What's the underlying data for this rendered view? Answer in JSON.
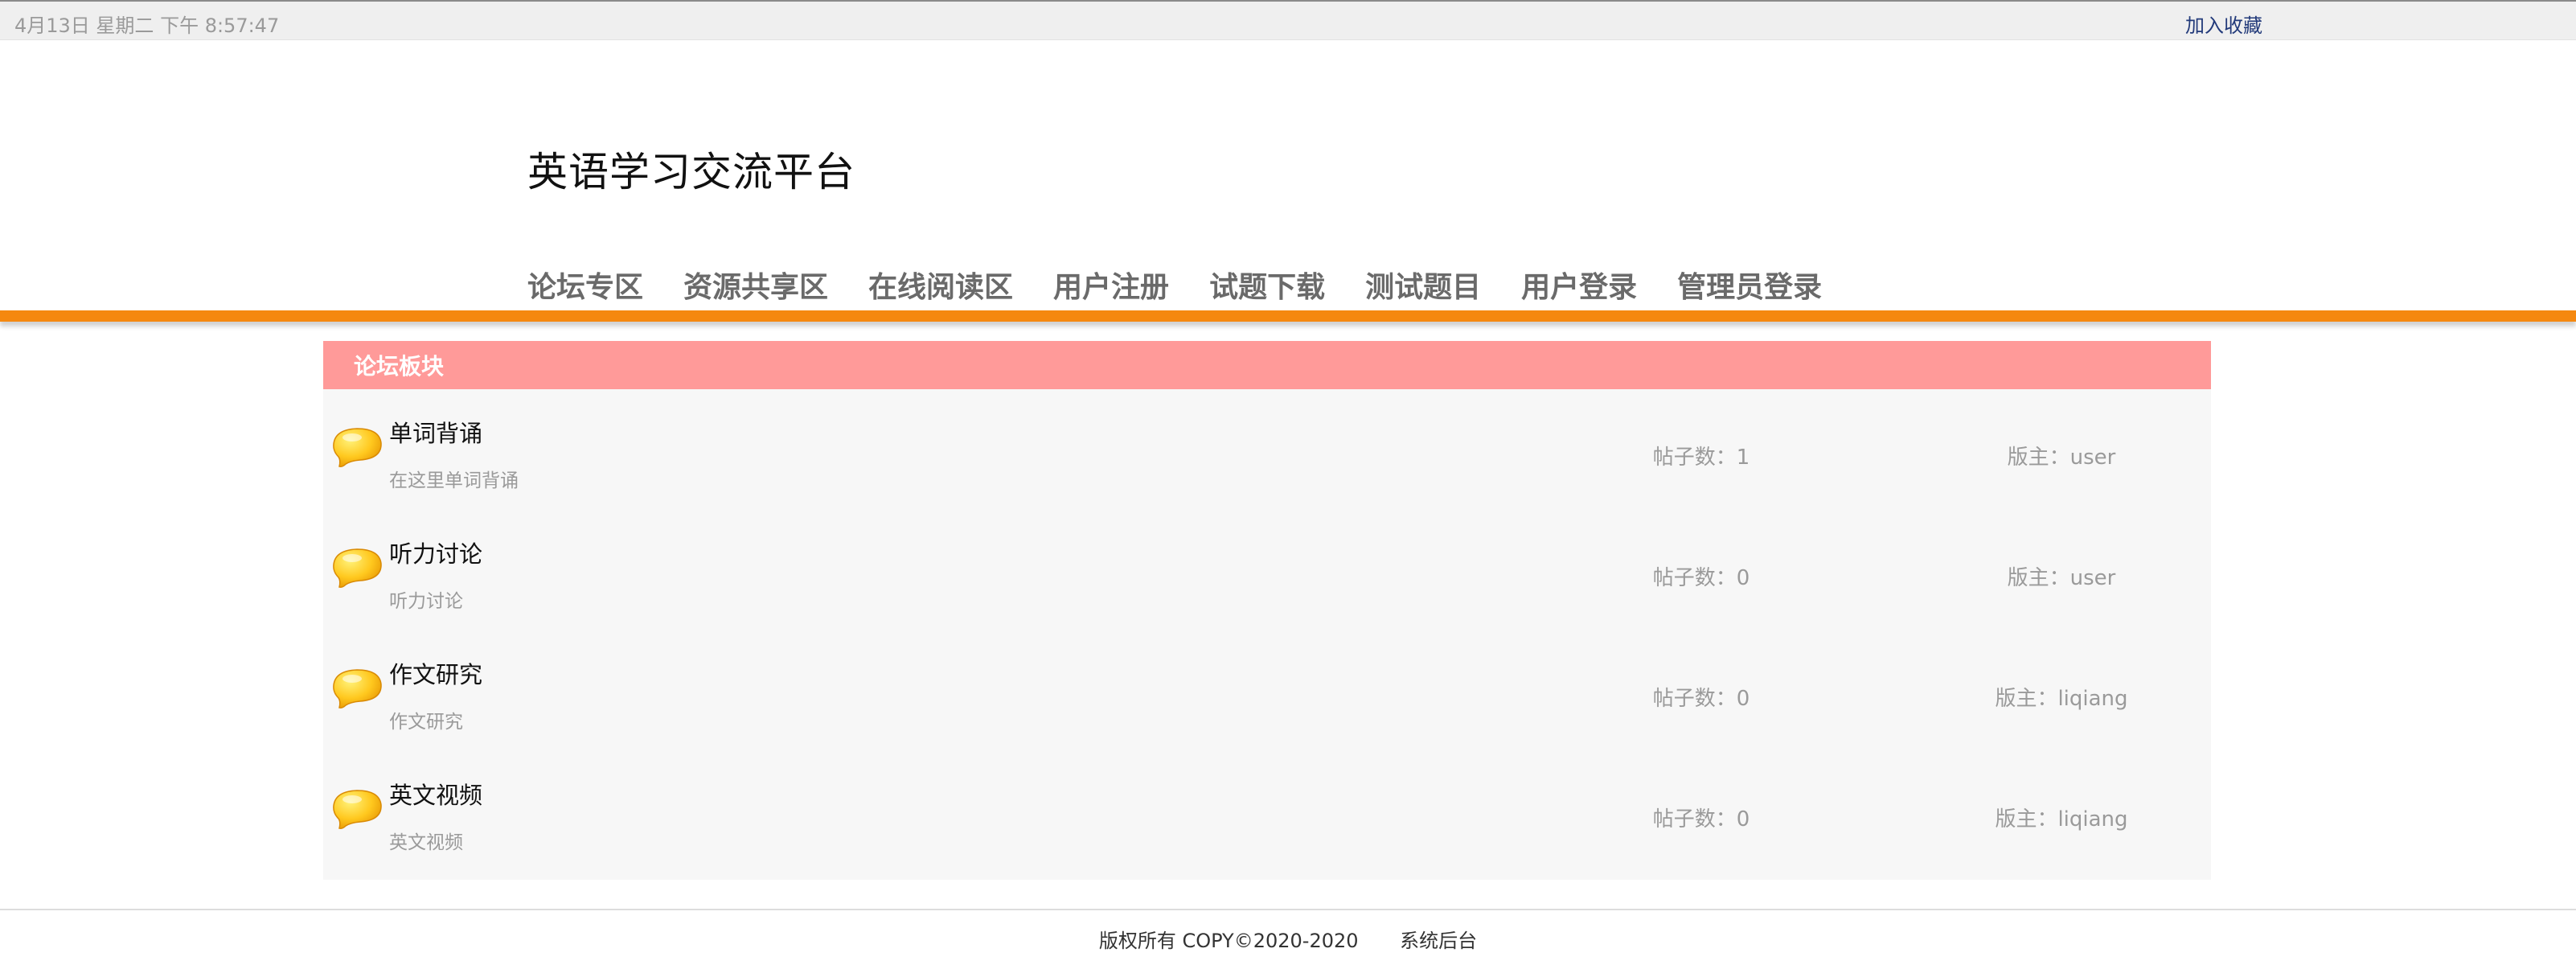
{
  "topbar": {
    "datetime": "4月13日 星期二 下午 8:57:47",
    "bookmark_label": "加入收藏"
  },
  "header": {
    "site_title": "英语学习交流平台"
  },
  "nav": {
    "items": [
      {
        "label": "论坛专区"
      },
      {
        "label": "资源共享区"
      },
      {
        "label": "在线阅读区"
      },
      {
        "label": "用户注册"
      },
      {
        "label": "试题下载"
      },
      {
        "label": "测试题目"
      },
      {
        "label": "用户登录"
      },
      {
        "label": "管理员登录"
      }
    ]
  },
  "board": {
    "title": "论坛板块",
    "forums": [
      {
        "name": "单词背诵",
        "description": "在这里单词背诵",
        "posts": "帖子数：1",
        "moderator": "版主：user"
      },
      {
        "name": "听力讨论",
        "description": "听力讨论",
        "posts": "帖子数：0",
        "moderator": "版主：user"
      },
      {
        "name": "作文研究",
        "description": "作文研究",
        "posts": "帖子数：0",
        "moderator": "版主：liqiang"
      },
      {
        "name": "英文视频",
        "description": "英文视频",
        "posts": "帖子数：0",
        "moderator": "版主：liqiang"
      }
    ],
    "icon": "chat-bubble-icon"
  },
  "footer": {
    "copyright": "版权所有 COPY©2020-2020",
    "admin_link": "系统后台"
  },
  "colors": {
    "accent_orange": "#f5880f",
    "board_header": "#ff9a99",
    "bookmark_link": "#223a7a"
  }
}
